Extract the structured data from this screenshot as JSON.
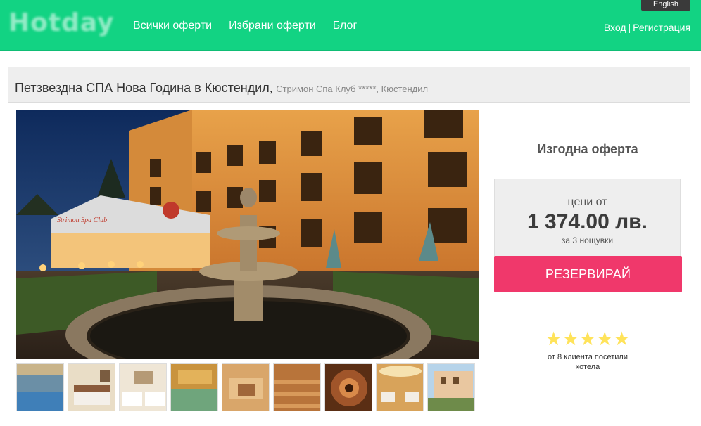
{
  "header": {
    "logo_text": "Hotday",
    "nav": [
      {
        "label": "Всички оферти"
      },
      {
        "label": "Избрани оферти"
      },
      {
        "label": "Блог"
      }
    ],
    "language": "English",
    "login": "Вход",
    "separator": "|",
    "register": "Регистрация",
    "accent_color": "#12d383"
  },
  "offer": {
    "title": "Петзвездна СПА Нова Година в Кюстендил,",
    "hotel": "Стримон Спа Клуб *****",
    "city": ", Кюстендил",
    "photo_sign": "Strimon Spa Club",
    "thumbnails": [
      {
        "name": "indoor-pool"
      },
      {
        "name": "bedroom"
      },
      {
        "name": "twin-room"
      },
      {
        "name": "spa-pool"
      },
      {
        "name": "sauna"
      },
      {
        "name": "wooden-sauna"
      },
      {
        "name": "spa-bowl"
      },
      {
        "name": "restaurant"
      },
      {
        "name": "hotel-exterior"
      }
    ]
  },
  "sidebar": {
    "deal_heading": "Изгодна оферта",
    "price_from": "цени от",
    "price": "1 374.00 лв.",
    "nights": "за 3 нощувки",
    "book_button": "РЕЗЕРВИРАЙ",
    "button_color": "#f0386b",
    "stars": "★★★★★",
    "rating": 5,
    "rating_text": "от 8 клиента посетили хотела"
  }
}
